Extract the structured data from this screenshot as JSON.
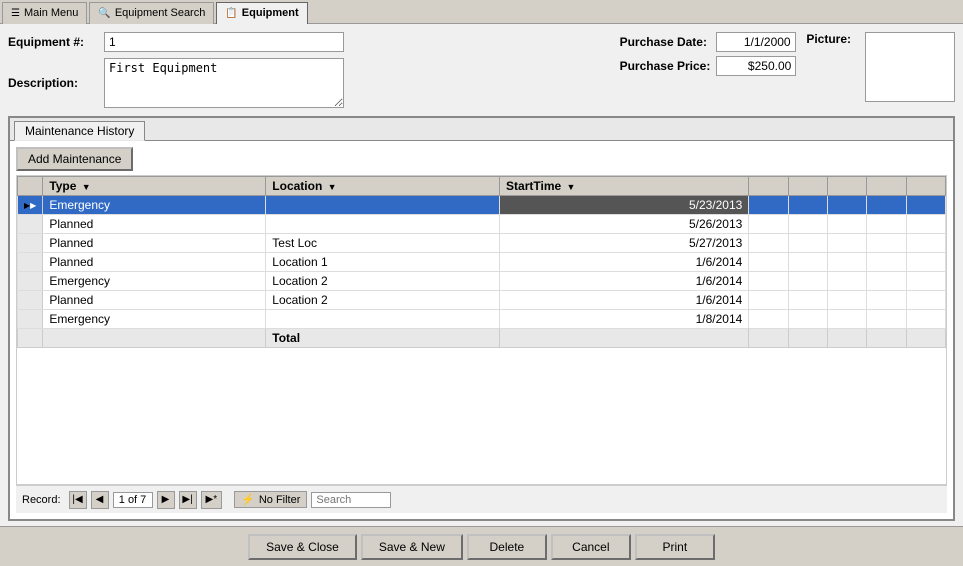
{
  "tabs": [
    {
      "id": "main-menu",
      "label": "Main Menu",
      "icon": "☰",
      "active": false
    },
    {
      "id": "equipment-search",
      "label": "Equipment Search",
      "icon": "🔍",
      "active": false
    },
    {
      "id": "equipment",
      "label": "Equipment",
      "icon": "📋",
      "active": true
    }
  ],
  "form": {
    "equipment_number_label": "Equipment #:",
    "equipment_number_value": "1",
    "description_label": "Description:",
    "description_value": "First Equipment",
    "purchase_date_label": "Purchase Date:",
    "purchase_date_value": "1/1/2000",
    "purchase_price_label": "Purchase Price:",
    "purchase_price_value": "$250.00",
    "picture_label": "Picture:"
  },
  "maintenance_tab": {
    "tab_label": "Maintenance History",
    "add_button_label": "Add Maintenance",
    "columns": [
      {
        "key": "type",
        "label": "Type"
      },
      {
        "key": "location",
        "label": "Location"
      },
      {
        "key": "start_time",
        "label": "StartTime"
      }
    ],
    "rows": [
      {
        "id": 1,
        "type": "Emergency",
        "location": "",
        "start_time": "5/23/2013",
        "selected": true,
        "date_highlighted": true
      },
      {
        "id": 2,
        "type": "Planned",
        "location": "",
        "start_time": "5/26/2013",
        "selected": false
      },
      {
        "id": 3,
        "type": "Planned",
        "location": "Test Loc",
        "start_time": "5/27/2013",
        "selected": false
      },
      {
        "id": 4,
        "type": "Planned",
        "location": "Location 1",
        "start_time": "1/6/2014",
        "selected": false
      },
      {
        "id": 5,
        "type": "Emergency",
        "location": "Location 2",
        "start_time": "1/6/2014",
        "selected": false
      },
      {
        "id": 6,
        "type": "Planned",
        "location": "Location 2",
        "start_time": "1/6/2014",
        "selected": false
      },
      {
        "id": 7,
        "type": "Emergency",
        "location": "",
        "start_time": "1/8/2014",
        "selected": false
      }
    ],
    "footer": {
      "total_label": "Total",
      "col1": "",
      "col2": ""
    }
  },
  "record_nav": {
    "label": "Record:",
    "current": "1 of 7",
    "no_filter_label": "No Filter",
    "search_placeholder": "Search"
  },
  "bottom_buttons": [
    {
      "id": "save-close",
      "label": "Save & Close"
    },
    {
      "id": "save-new",
      "label": "Save & New"
    },
    {
      "id": "delete",
      "label": "Delete"
    },
    {
      "id": "cancel",
      "label": "Cancel"
    },
    {
      "id": "print",
      "label": "Print"
    }
  ]
}
